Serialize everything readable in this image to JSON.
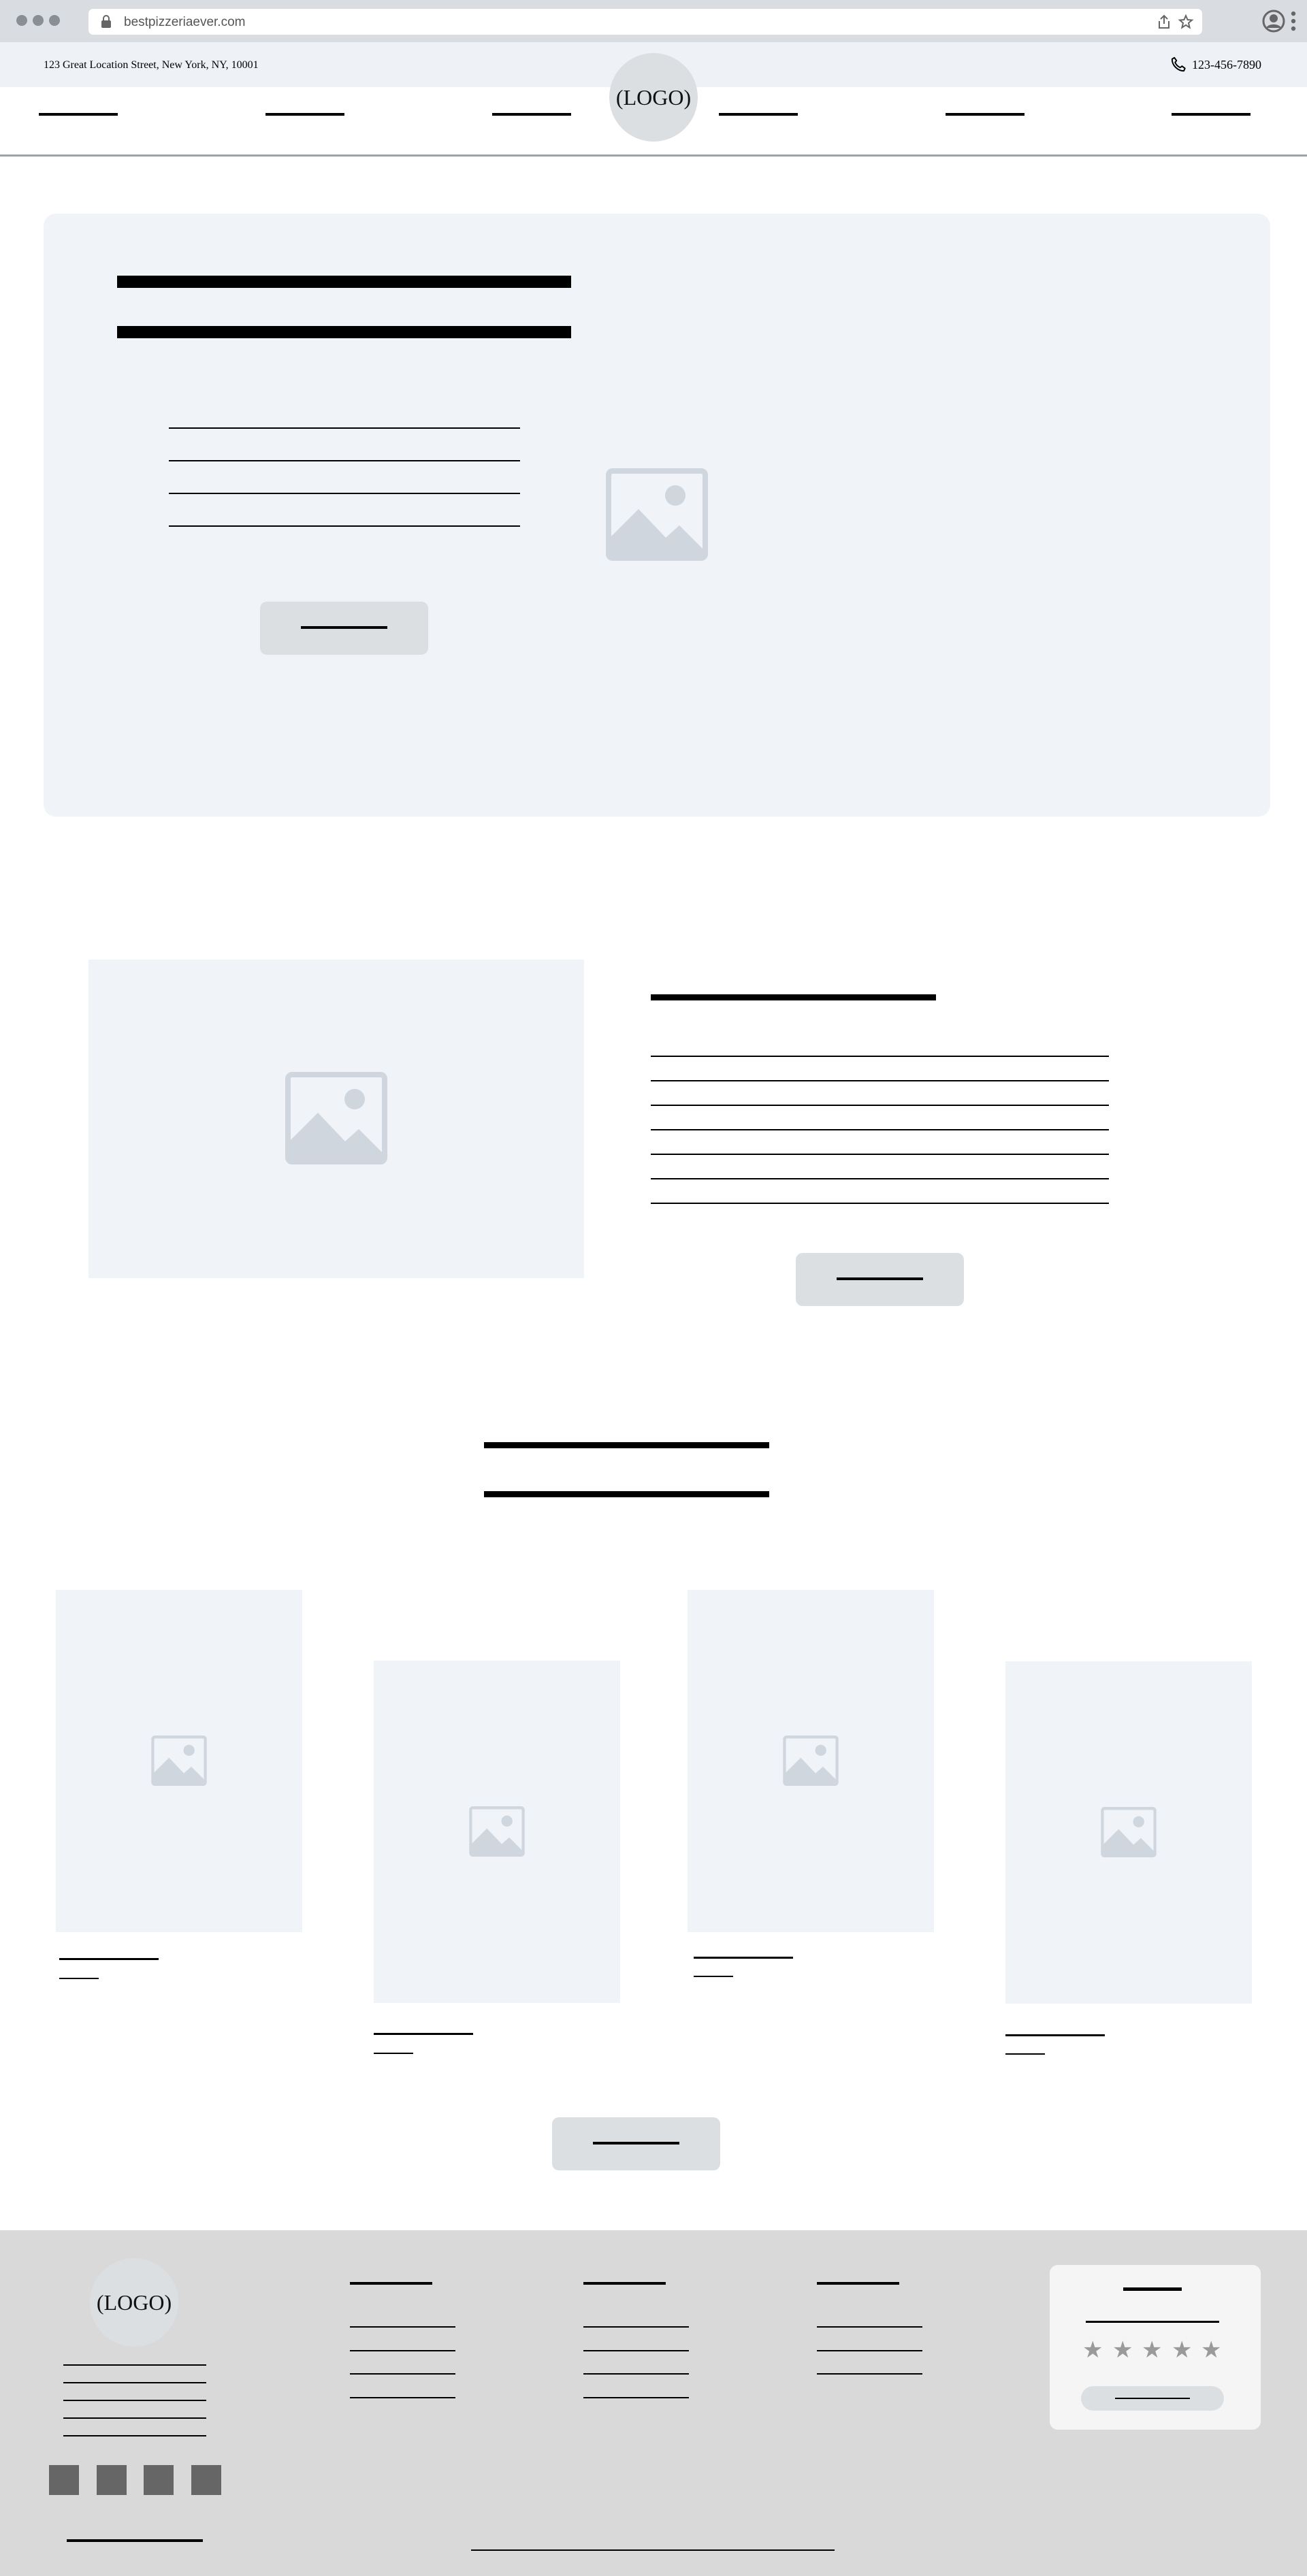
{
  "browser": {
    "url": "bestpizzeriaever.com",
    "icons": [
      "lock-icon",
      "share-icon",
      "star-icon",
      "account-icon",
      "more-icon"
    ]
  },
  "topbar": {
    "address": "123 Great Location Street, New York, NY, 10001",
    "phone": "123-456-7890",
    "phone_icon": "phone-icon"
  },
  "header": {
    "logo_text": "(LOGO)"
  },
  "footer": {
    "logo_text": "(LOGO)",
    "rating_stars": [
      "★",
      "★",
      "★",
      "★",
      "★"
    ]
  },
  "colors": {
    "chrome": "#d9dde1",
    "infobar": "#eef2f7",
    "panel": "#f0f3f7",
    "button": "#dcdfe2",
    "footer": "#d9d9d9",
    "placeholder_icon": "#cfd6de"
  }
}
